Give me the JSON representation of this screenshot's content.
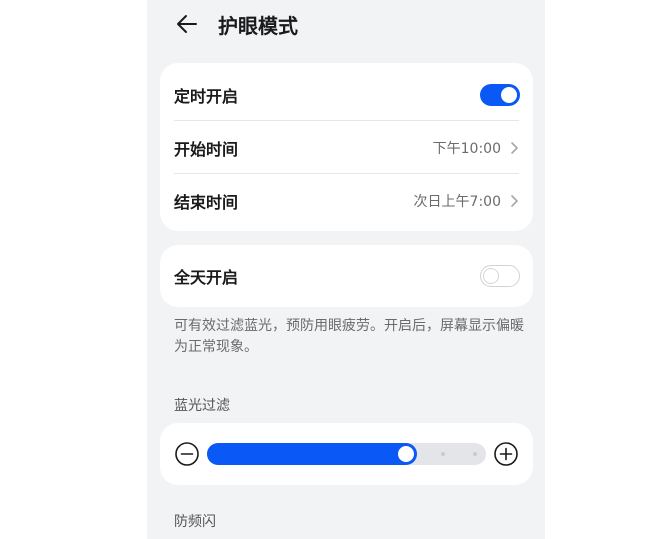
{
  "header": {
    "title": "护眼模式",
    "back_icon": "arrow-left-icon"
  },
  "schedule": {
    "timer_label": "定时开启",
    "timer_enabled": true,
    "start_label": "开始时间",
    "start_value": "下午10:00",
    "end_label": "结束时间",
    "end_value": "次日上午7:00"
  },
  "all_day": {
    "label": "全天开启",
    "enabled": false
  },
  "hint": "可有效过滤蓝光，预防用眼疲劳。开启后，屏幕显示偏暖为正常现象。",
  "blue_filter": {
    "section_label": "蓝光过滤",
    "level": 0.73,
    "minus_icon": "minus-circle-icon",
    "plus_icon": "plus-circle-icon"
  },
  "anti_flicker": {
    "section_label": "防频闪"
  },
  "colors": {
    "accent": "#0a59f7",
    "panel_bg": "#f1f3f5"
  }
}
